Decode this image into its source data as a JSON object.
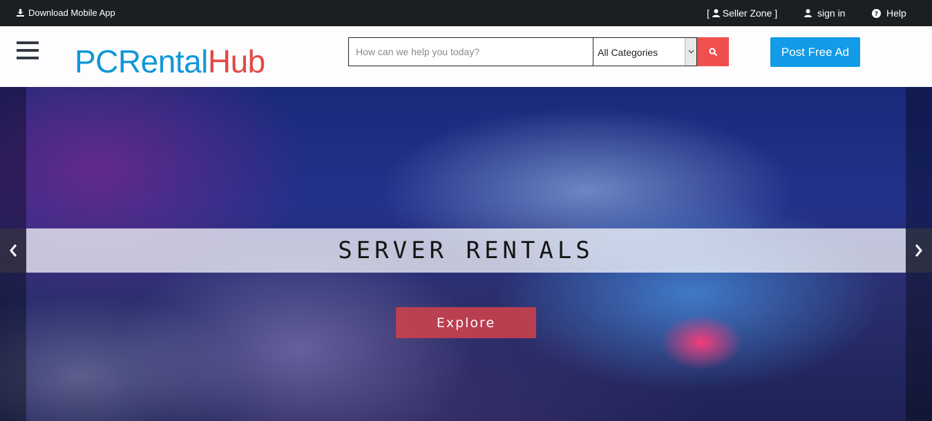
{
  "topbar": {
    "download_label": "Download Mobile App",
    "seller_zone_label": "[  Seller Zone ]",
    "sign_in_label": "sign in",
    "help_label": "Help"
  },
  "header": {
    "logo_part1": "PCRental",
    "logo_part2": "Hub",
    "search_placeholder": "How can we help you today?",
    "search_value": "",
    "category_selected": "All Categories",
    "post_ad_label": "Post Free Ad"
  },
  "hero": {
    "slide_title": "SERVER RENTALS",
    "cta_label": "Explore",
    "prev_symbol": "‹",
    "next_symbol": "›"
  },
  "colors": {
    "topbar_bg": "#1b1f22",
    "logo_blue": "#1296d9",
    "logo_red": "#e54848",
    "search_button": "#f04f4f",
    "post_button": "#129be6",
    "explore_button": "#cd414b"
  },
  "icons": {
    "download": "download-icon",
    "seller": "user-icon",
    "signin": "user-icon",
    "help": "question-circle-icon",
    "search": "search-icon",
    "menu": "hamburger-menu-icon",
    "caret": "chevron-down-icon",
    "prev": "chevron-left-icon",
    "next": "chevron-right-icon"
  }
}
